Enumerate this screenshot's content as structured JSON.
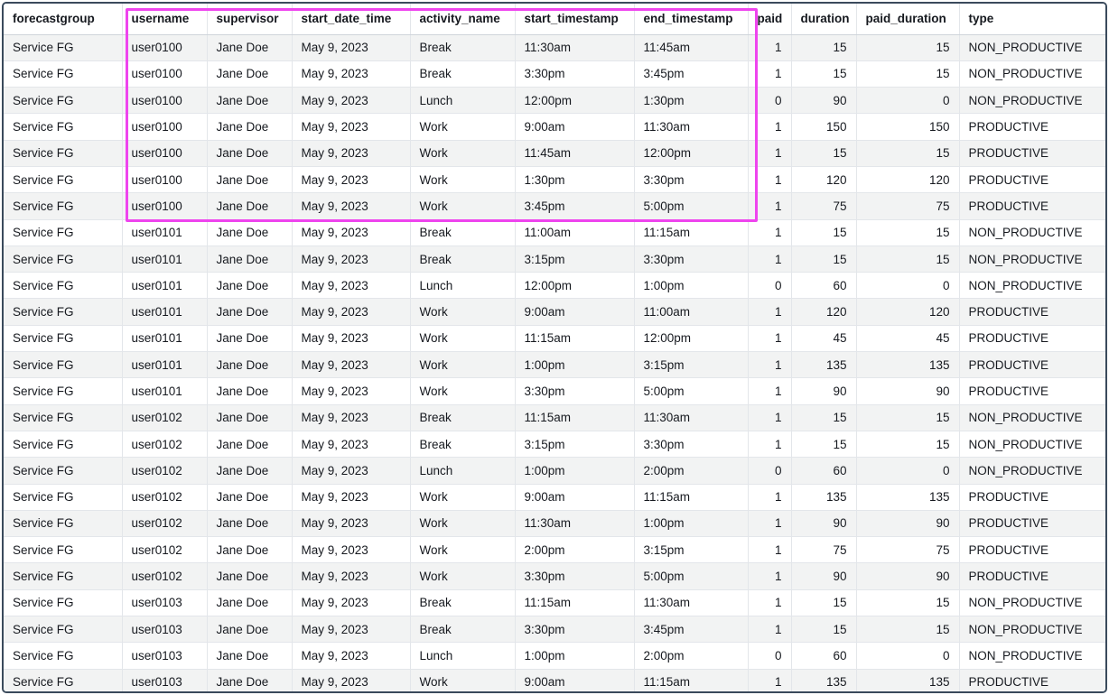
{
  "table": {
    "columns": [
      {
        "key": "forecastgroup",
        "label": "forecastgroup"
      },
      {
        "key": "username",
        "label": "username"
      },
      {
        "key": "supervisor",
        "label": "supervisor"
      },
      {
        "key": "start_date_time",
        "label": "start_date_time"
      },
      {
        "key": "activity_name",
        "label": "activity_name"
      },
      {
        "key": "start_timestamp",
        "label": "start_timestamp"
      },
      {
        "key": "end_timestamp",
        "label": "end_timestamp"
      },
      {
        "key": "paid",
        "label": "paid"
      },
      {
        "key": "duration",
        "label": "duration"
      },
      {
        "key": "paid_duration",
        "label": "paid_duration"
      },
      {
        "key": "type",
        "label": "type"
      }
    ],
    "rows": [
      [
        "Service FG",
        "user0100",
        "Jane Doe",
        "May 9, 2023",
        "Break",
        "11:30am",
        "11:45am",
        "1",
        "15",
        "15",
        "NON_PRODUCTIVE"
      ],
      [
        "Service FG",
        "user0100",
        "Jane Doe",
        "May 9, 2023",
        "Break",
        "3:30pm",
        "3:45pm",
        "1",
        "15",
        "15",
        "NON_PRODUCTIVE"
      ],
      [
        "Service FG",
        "user0100",
        "Jane Doe",
        "May 9, 2023",
        "Lunch",
        "12:00pm",
        "1:30pm",
        "0",
        "90",
        "0",
        "NON_PRODUCTIVE"
      ],
      [
        "Service FG",
        "user0100",
        "Jane Doe",
        "May 9, 2023",
        "Work",
        "9:00am",
        "11:30am",
        "1",
        "150",
        "150",
        "PRODUCTIVE"
      ],
      [
        "Service FG",
        "user0100",
        "Jane Doe",
        "May 9, 2023",
        "Work",
        "11:45am",
        "12:00pm",
        "1",
        "15",
        "15",
        "PRODUCTIVE"
      ],
      [
        "Service FG",
        "user0100",
        "Jane Doe",
        "May 9, 2023",
        "Work",
        "1:30pm",
        "3:30pm",
        "1",
        "120",
        "120",
        "PRODUCTIVE"
      ],
      [
        "Service FG",
        "user0100",
        "Jane Doe",
        "May 9, 2023",
        "Work",
        "3:45pm",
        "5:00pm",
        "1",
        "75",
        "75",
        "PRODUCTIVE"
      ],
      [
        "Service FG",
        "user0101",
        "Jane Doe",
        "May 9, 2023",
        "Break",
        "11:00am",
        "11:15am",
        "1",
        "15",
        "15",
        "NON_PRODUCTIVE"
      ],
      [
        "Service FG",
        "user0101",
        "Jane Doe",
        "May 9, 2023",
        "Break",
        "3:15pm",
        "3:30pm",
        "1",
        "15",
        "15",
        "NON_PRODUCTIVE"
      ],
      [
        "Service FG",
        "user0101",
        "Jane Doe",
        "May 9, 2023",
        "Lunch",
        "12:00pm",
        "1:00pm",
        "0",
        "60",
        "0",
        "NON_PRODUCTIVE"
      ],
      [
        "Service FG",
        "user0101",
        "Jane Doe",
        "May 9, 2023",
        "Work",
        "9:00am",
        "11:00am",
        "1",
        "120",
        "120",
        "PRODUCTIVE"
      ],
      [
        "Service FG",
        "user0101",
        "Jane Doe",
        "May 9, 2023",
        "Work",
        "11:15am",
        "12:00pm",
        "1",
        "45",
        "45",
        "PRODUCTIVE"
      ],
      [
        "Service FG",
        "user0101",
        "Jane Doe",
        "May 9, 2023",
        "Work",
        "1:00pm",
        "3:15pm",
        "1",
        "135",
        "135",
        "PRODUCTIVE"
      ],
      [
        "Service FG",
        "user0101",
        "Jane Doe",
        "May 9, 2023",
        "Work",
        "3:30pm",
        "5:00pm",
        "1",
        "90",
        "90",
        "PRODUCTIVE"
      ],
      [
        "Service FG",
        "user0102",
        "Jane Doe",
        "May 9, 2023",
        "Break",
        "11:15am",
        "11:30am",
        "1",
        "15",
        "15",
        "NON_PRODUCTIVE"
      ],
      [
        "Service FG",
        "user0102",
        "Jane Doe",
        "May 9, 2023",
        "Break",
        "3:15pm",
        "3:30pm",
        "1",
        "15",
        "15",
        "NON_PRODUCTIVE"
      ],
      [
        "Service FG",
        "user0102",
        "Jane Doe",
        "May 9, 2023",
        "Lunch",
        "1:00pm",
        "2:00pm",
        "0",
        "60",
        "0",
        "NON_PRODUCTIVE"
      ],
      [
        "Service FG",
        "user0102",
        "Jane Doe",
        "May 9, 2023",
        "Work",
        "9:00am",
        "11:15am",
        "1",
        "135",
        "135",
        "PRODUCTIVE"
      ],
      [
        "Service FG",
        "user0102",
        "Jane Doe",
        "May 9, 2023",
        "Work",
        "11:30am",
        "1:00pm",
        "1",
        "90",
        "90",
        "PRODUCTIVE"
      ],
      [
        "Service FG",
        "user0102",
        "Jane Doe",
        "May 9, 2023",
        "Work",
        "2:00pm",
        "3:15pm",
        "1",
        "75",
        "75",
        "PRODUCTIVE"
      ],
      [
        "Service FG",
        "user0102",
        "Jane Doe",
        "May 9, 2023",
        "Work",
        "3:30pm",
        "5:00pm",
        "1",
        "90",
        "90",
        "PRODUCTIVE"
      ],
      [
        "Service FG",
        "user0103",
        "Jane Doe",
        "May 9, 2023",
        "Break",
        "11:15am",
        "11:30am",
        "1",
        "15",
        "15",
        "NON_PRODUCTIVE"
      ],
      [
        "Service FG",
        "user0103",
        "Jane Doe",
        "May 9, 2023",
        "Break",
        "3:30pm",
        "3:45pm",
        "1",
        "15",
        "15",
        "NON_PRODUCTIVE"
      ],
      [
        "Service FG",
        "user0103",
        "Jane Doe",
        "May 9, 2023",
        "Lunch",
        "1:00pm",
        "2:00pm",
        "0",
        "60",
        "0",
        "NON_PRODUCTIVE"
      ],
      [
        "Service FG",
        "user0103",
        "Jane Doe",
        "May 9, 2023",
        "Work",
        "9:00am",
        "11:15am",
        "1",
        "135",
        "135",
        "PRODUCTIVE"
      ]
    ]
  },
  "highlight": {
    "color": "#ee44ee"
  }
}
